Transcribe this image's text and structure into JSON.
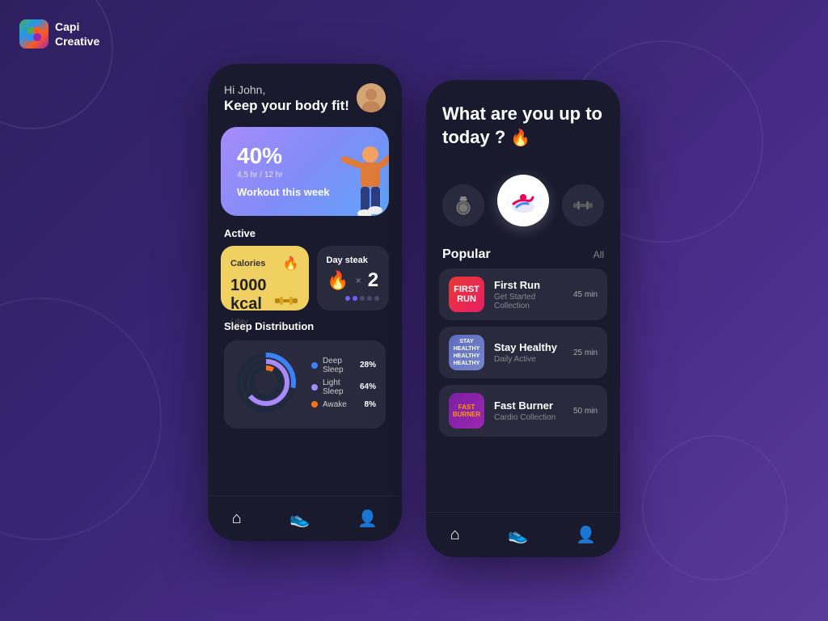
{
  "logo": {
    "name": "Capi",
    "name2": "Creative"
  },
  "phone1": {
    "greeting": "Hi John,",
    "title": "Keep your body fit!",
    "workout_card": {
      "percent": "40%",
      "hours": "4,5 hr / 12 hr",
      "label": "Workout this week"
    },
    "active_section": {
      "label": "Active",
      "calories": {
        "title": "Calories",
        "value": "1000 kcal",
        "unit": "/ day"
      },
      "day_steak": {
        "title": "Day steak",
        "count": "2"
      }
    },
    "sleep": {
      "title": "Sleep Distribution",
      "deep_sleep": {
        "label": "Deep Sleep",
        "pct": "28%",
        "color": "#3b82f6"
      },
      "light_sleep": {
        "label": "Light Sleep",
        "pct": "64%",
        "color": "#a78bfa"
      },
      "awake": {
        "label": "Awake",
        "pct": "8%",
        "color": "#f97316"
      }
    },
    "nav": {
      "home": "🏠",
      "activity": "👟",
      "profile": "👤"
    }
  },
  "phone2": {
    "title": "What are you up to today ?",
    "fire_emoji": "🔥",
    "activities": [
      {
        "icon": "🏅",
        "label": "medal",
        "active": false
      },
      {
        "icon": "👟",
        "label": "running",
        "active": true
      },
      {
        "icon": "🏋️",
        "label": "weight",
        "active": false
      }
    ],
    "popular": {
      "title": "Popular",
      "all_label": "All",
      "items": [
        {
          "name": "First Run",
          "sub": "Get Started Collection",
          "time": "45 min",
          "thumb_text": "FIRST RUN",
          "type": "first-run"
        },
        {
          "name": "Stay Healthy",
          "sub": "Daily Active",
          "time": "25 min",
          "thumb_text": "STAY HEALTHY HEALTHY HEALTHY",
          "type": "stay-healthy"
        },
        {
          "name": "Fast Burner",
          "sub": "Cardio Collection",
          "time": "50 min",
          "thumb_text": "FAST BURNER",
          "type": "fast-burner"
        }
      ]
    },
    "nav": {
      "home": "🏠",
      "activity": "👟",
      "profile": "👤"
    }
  }
}
